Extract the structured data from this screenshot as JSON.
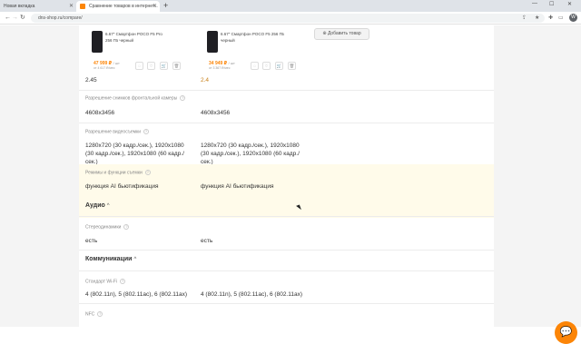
{
  "browser": {
    "tabs": [
      {
        "label": "Новая вкладка"
      },
      {
        "label": "Сравнение товаров в интернет..."
      }
    ],
    "new_tab": "+",
    "url": "dns-shop.ru/compare/",
    "profile_initial": "W",
    "window_controls": {
      "minimize": "—",
      "maximize": "☐",
      "close": "✕"
    }
  },
  "products": [
    {
      "name": "6.67\" Смартфон POCO F5 Pro 256 ГБ черный",
      "price": "47 999 ₽",
      "price_unit": "/ шт",
      "credit": "от 4 617 ₽/мес"
    },
    {
      "name": "6.67\" Смартфон POCO F5 256 ГБ черный",
      "price": "34 949 ₽",
      "price_unit": "/ шт",
      "credit": "от 3 367 ₽/мес"
    }
  ],
  "add_product_label": "Добавить товар",
  "specs": {
    "aperture": {
      "v1": "2.45",
      "v2": "2.4"
    },
    "front_camera_resolution": {
      "label": "Разрешение снимков фронтальной камеры",
      "v1": "4608x3456",
      "v2": "4608x3456"
    },
    "video_resolution": {
      "label": "Разрешение видеосъемки",
      "v1": "1280x720 (30 кадр./сек.), 1920x1080 (30 кадр./сек.), 1920x1080 (60 кадр./сек.)",
      "v2": "1280x720 (30 кадр./сек.), 1920x1080 (30 кадр./сек.), 1920x1080 (60 кадр./сек.)"
    },
    "shooting_modes": {
      "label": "Режимы и функции съемки",
      "v1": "функция AI бьютификация",
      "v2": "функция AI бьютификация"
    },
    "audio_section": "Аудио",
    "stereo_speakers": {
      "label": "Стереодинамики",
      "v1": "есть",
      "v2": "есть"
    },
    "comm_section": "Коммуникации",
    "wifi_standard": {
      "label": "Стандарт Wi-Fi",
      "v1": "4 (802.11n), 5 (802.11ac), 6 (802.11ax)",
      "v2": "4 (802.11n), 5 (802.11ac), 6 (802.11ax)"
    },
    "nfc": {
      "label": "NFC"
    }
  },
  "colors": {
    "accent": "#fc8507",
    "highlight_row": "#fffbea"
  }
}
